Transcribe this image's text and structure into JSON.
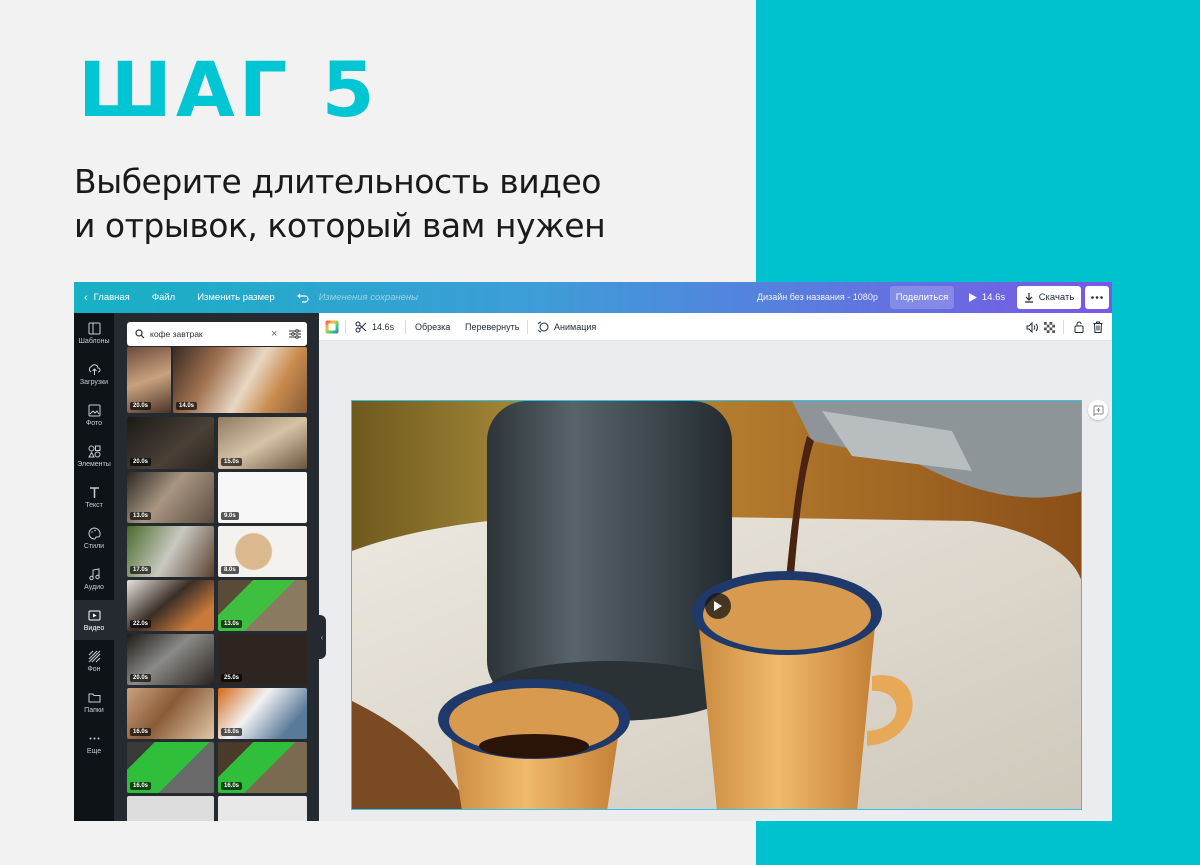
{
  "slide": {
    "title": "ШАГ 5",
    "description_line1": "Выберите длительность видео",
    "description_line2": "и отрывок, который вам нужен",
    "accent_color": "#00c2cf"
  },
  "topbar": {
    "home_label": "Главная",
    "file_label": "Файл",
    "resize_label": "Изменить размер",
    "saved_status": "Изменения сохранены",
    "design_name": "Дизайн без названия - 1080p",
    "share_label": "Поделиться",
    "play_duration": "14.6s",
    "download_label": "Скачать"
  },
  "sidebar": {
    "items": [
      {
        "label": "Шаблоны",
        "icon": "templates-icon"
      },
      {
        "label": "Загрузки",
        "icon": "upload-icon"
      },
      {
        "label": "Фото",
        "icon": "photo-icon"
      },
      {
        "label": "Элементы",
        "icon": "elements-icon"
      },
      {
        "label": "Текст",
        "icon": "text-icon"
      },
      {
        "label": "Стили",
        "icon": "palette-icon"
      },
      {
        "label": "Аудио",
        "icon": "music-icon"
      },
      {
        "label": "Видео",
        "icon": "video-icon"
      },
      {
        "label": "Фон",
        "icon": "background-icon"
      },
      {
        "label": "Папки",
        "icon": "folder-icon"
      },
      {
        "label": "Еще",
        "icon": "more-icon"
      }
    ],
    "active": "Видео"
  },
  "panel": {
    "search_value": "кофе завтрак",
    "durations": [
      "20.0s",
      "14.0s",
      "20.0s",
      "15.0s",
      "13.0s",
      "9.0s",
      "17.0s",
      "8.0s",
      "22.0s",
      "13.0s",
      "20.0s",
      "25.0s",
      "16.0s",
      "16.0s",
      "16.0s",
      "16.0s"
    ]
  },
  "toolbar": {
    "duration": "14.6s",
    "trim_label": "Обрезка",
    "flip_label": "Перевернуть",
    "animation_label": "Анимация"
  }
}
